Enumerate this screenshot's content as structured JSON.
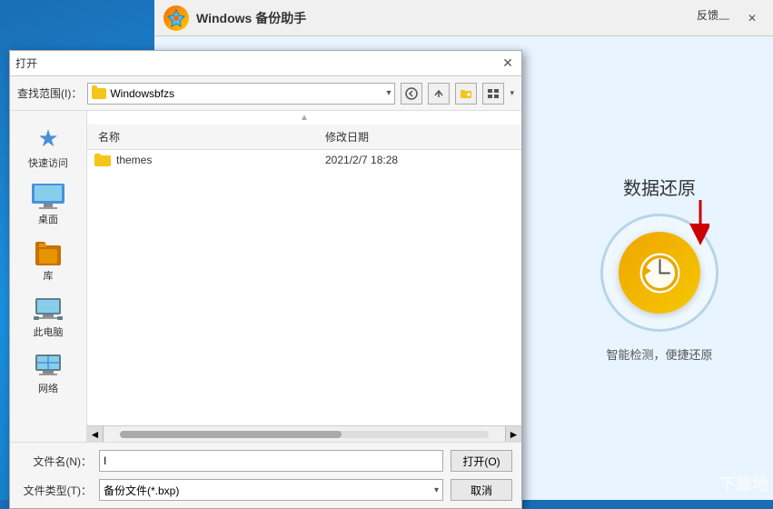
{
  "bg": {
    "title": "Windows 备份助手",
    "feedback": "反馈",
    "minimize": "—",
    "close": "✕",
    "restore_title": "数据还原",
    "restore_subtitle": "智能检测，便捷还原",
    "app_icon": "⚡"
  },
  "dialog": {
    "title": "打开",
    "close": "✕",
    "search_scope_label": "查找范围(I)：",
    "current_folder": "Windowsbfzs",
    "columns": {
      "name": "名称",
      "date": "修改日期",
      "type": ""
    },
    "files": [
      {
        "name": "themes",
        "date": "2021/2/7 18:28",
        "type": ""
      }
    ],
    "sidebar_items": [
      {
        "label": "快速访问",
        "icon": "star"
      },
      {
        "label": "桌面",
        "icon": "desktop"
      },
      {
        "label": "库",
        "icon": "folder_brown"
      },
      {
        "label": "此电脑",
        "icon": "computer"
      },
      {
        "label": "网络",
        "icon": "network"
      }
    ],
    "filename_label": "文件名(N)：",
    "filetype_label": "文件类型(T)：",
    "filename_value": "I",
    "filetype_value": "备份文件(*.bxp)",
    "open_btn": "打开(O)",
    "cancel_btn": "取消"
  },
  "watermark": "下载地"
}
